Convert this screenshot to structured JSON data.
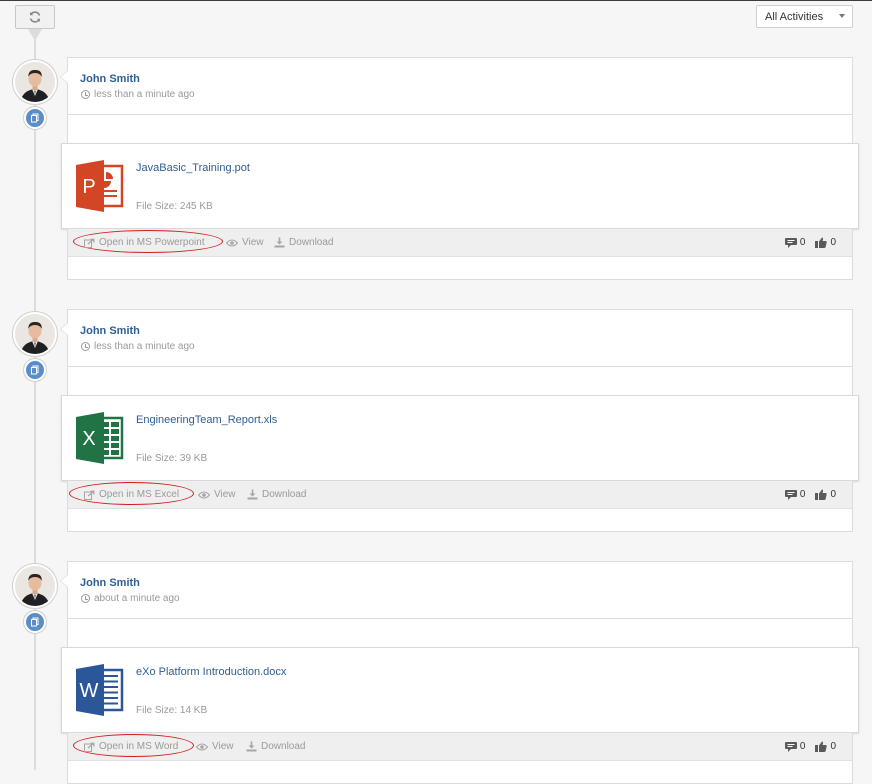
{
  "toolbar": {
    "refresh_icon": "refresh-icon",
    "filter_label": "All Activities"
  },
  "activities": [
    {
      "author": "John Smith",
      "time": "less than a minute ago",
      "file_name": "JavaBasic_Training.pot",
      "file_size": "File Size:  245 KB",
      "file_type": "powerpoint",
      "file_color": "#d24625",
      "open_label": "Open in MS Powerpoint",
      "view_label": "View",
      "download_label": "Download",
      "comments": "0",
      "likes": "0"
    },
    {
      "author": "John Smith",
      "time": "less than a minute ago",
      "file_name": "EngineeringTeam_Report.xls",
      "file_size": "File Size:  39 KB",
      "file_type": "excel",
      "file_color": "#217346",
      "open_label": "Open in MS Excel",
      "view_label": "View",
      "download_label": "Download",
      "comments": "0",
      "likes": "0"
    },
    {
      "author": "John Smith",
      "time": "about a minute ago",
      "file_name": "eXo Platform Introduction.docx",
      "file_size": "File Size:  14 KB",
      "file_type": "word",
      "file_color": "#2b579a",
      "open_label": "Open in MS Word",
      "view_label": "View",
      "download_label": "Download",
      "comments": "0",
      "likes": "0"
    }
  ]
}
